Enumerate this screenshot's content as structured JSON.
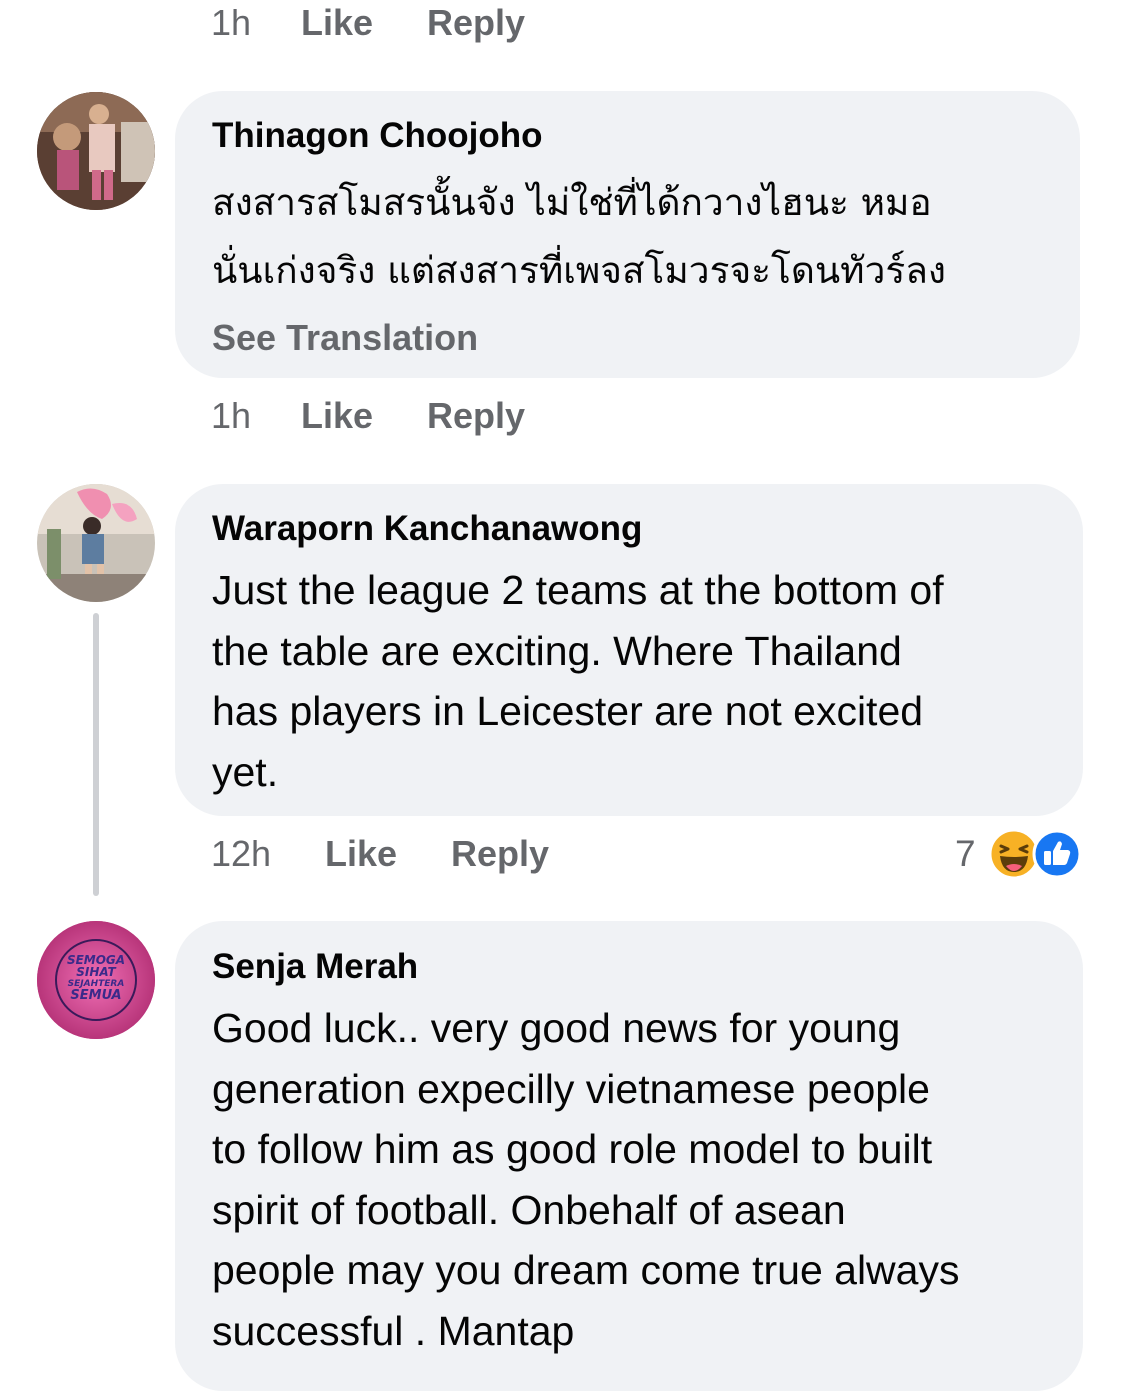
{
  "top_actions": {
    "time": "1h",
    "like": "Like",
    "reply": "Reply"
  },
  "comments": [
    {
      "author": "Thinagon Choojoho",
      "lines": [
        "สงสารสโมสรนั้นจัง ไม่ใช่ที่ได้กวางไฮนะ หมอ",
        "นั่นเก่งจริง แต่สงสารที่เพจสโมวรจะโดนทัวร์ลง"
      ],
      "see_translation": "See Translation",
      "time": "1h",
      "like": "Like",
      "reply": "Reply"
    },
    {
      "author": "Waraporn Kanchanawong",
      "lines": [
        "Just the league 2 teams at the bottom of",
        "the table are exciting. Where Thailand",
        "has players in Leicester are not excited",
        "yet."
      ],
      "time": "12h",
      "like": "Like",
      "reply": "Reply",
      "reaction_count": "7",
      "reactions": [
        "haha-icon",
        "like-icon"
      ]
    },
    {
      "author": "Senja Merah",
      "lines": [
        "Good luck..  very good news for young",
        "generation expecilly vietnamese people",
        "to follow him as good role model to built",
        "spirit of football.  Onbehalf of asean",
        "people may you dream come true always",
        "successful . Mantap"
      ],
      "avatar_text": [
        "SEMOGA",
        "SIHAT",
        "SEJAHTERA",
        "SEMUA"
      ]
    }
  ],
  "colors": {
    "bubble": "#f0f2f5",
    "meta": "#65676b",
    "text": "#050505",
    "like_blue": "#1877f2",
    "haha_yellow": "#f7b125"
  }
}
